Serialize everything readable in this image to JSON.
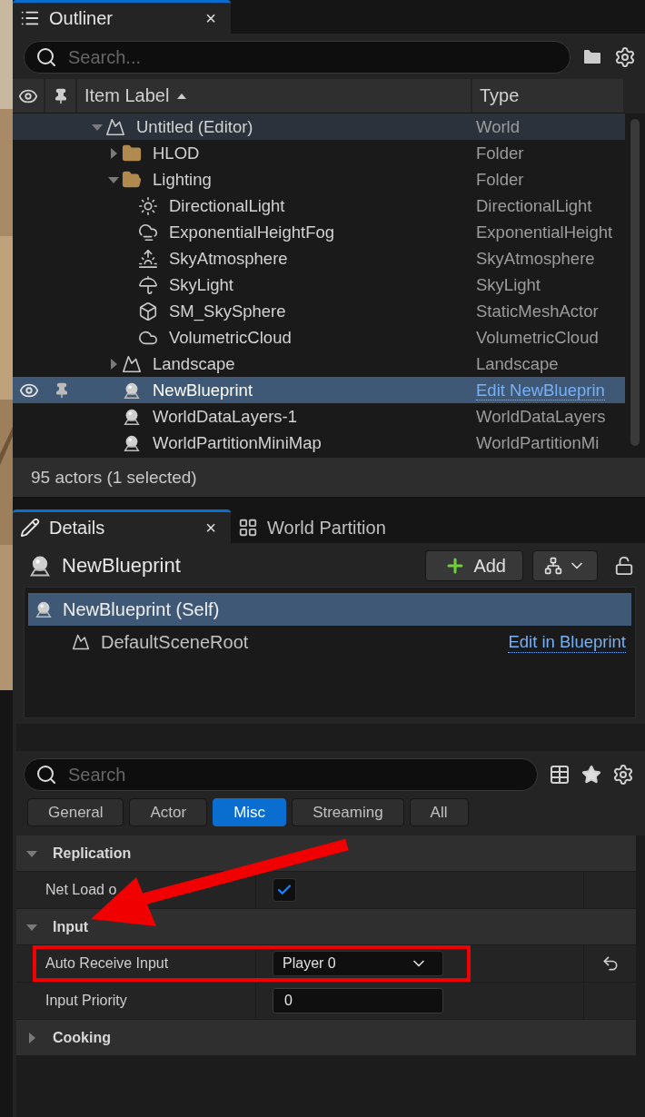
{
  "outliner": {
    "tab": {
      "label": "Outliner",
      "close": "×"
    },
    "search": {
      "placeholder": "Search..."
    },
    "columns": [
      {
        "label": "Item Label",
        "sorted": true
      },
      {
        "label": "Type",
        "sorted": false
      }
    ],
    "tree": [
      {
        "label": "Untitled (Editor)",
        "type": "World",
        "kind": "world",
        "type_link": false,
        "selected": false,
        "hovered": true,
        "expanded": true,
        "children": [
          {
            "label": "HLOD",
            "type": "Folder",
            "kind": "folder",
            "type_link": false,
            "selected": false,
            "hovered": false,
            "expanded": false
          },
          {
            "label": "Lighting",
            "type": "Folder",
            "kind": "folder",
            "type_link": false,
            "selected": false,
            "hovered": false,
            "expanded": true,
            "children": [
              {
                "label": "DirectionalLight",
                "type": "DirectionalLight",
                "kind": "directional-light",
                "type_link": false,
                "selected": false,
                "hovered": false
              },
              {
                "label": "ExponentialHeightFog",
                "type": "ExponentialHeight",
                "kind": "fog",
                "type_link": false,
                "selected": false,
                "hovered": false
              },
              {
                "label": "SkyAtmosphere",
                "type": "SkyAtmosphere",
                "kind": "atmosphere",
                "type_link": false,
                "selected": false,
                "hovered": false
              },
              {
                "label": "SkyLight",
                "type": "SkyLight",
                "kind": "skylight",
                "type_link": false,
                "selected": false,
                "hovered": false
              },
              {
                "label": "SM_SkySphere",
                "type": "StaticMeshActor",
                "kind": "mesh",
                "type_link": false,
                "selected": false,
                "hovered": false
              },
              {
                "label": "VolumetricCloud",
                "type": "VolumetricCloud",
                "kind": "cloud",
                "type_link": false,
                "selected": false,
                "hovered": false
              }
            ]
          },
          {
            "label": "Landscape",
            "type": "Landscape",
            "kind": "landscape",
            "type_link": false,
            "selected": false,
            "hovered": false,
            "expanded": false
          },
          {
            "label": "NewBlueprint",
            "type": "Edit NewBlueprin",
            "kind": "blueprint",
            "type_link": true,
            "selected": true,
            "hovered": false
          },
          {
            "label": "WorldDataLayers-1",
            "type": "WorldDataLayers",
            "kind": "blueprint",
            "type_link": false,
            "selected": false,
            "hovered": false
          },
          {
            "label": "WorldPartitionMiniMap",
            "type": "WorldPartitionMi",
            "kind": "blueprint",
            "type_link": false,
            "selected": false,
            "hovered": false
          }
        ]
      }
    ],
    "status": "95 actors (1 selected)"
  },
  "details": {
    "tabs": [
      {
        "label": "Details",
        "selected": true,
        "close": "×"
      },
      {
        "label": "World Partition",
        "selected": false
      }
    ],
    "actor_name": "NewBlueprint",
    "add_button": "Add",
    "components": [
      {
        "label": "NewBlueprint (Self)",
        "selected": true,
        "kind": "blueprint"
      },
      {
        "label": "DefaultSceneRoot",
        "selected": false,
        "kind": "scene-root",
        "link": "Edit in Blueprint"
      }
    ],
    "search": {
      "placeholder": "Search"
    },
    "filters": [
      {
        "label": "General",
        "selected": false
      },
      {
        "label": "Actor",
        "selected": false
      },
      {
        "label": "Misc",
        "selected": true
      },
      {
        "label": "Streaming",
        "selected": false
      },
      {
        "label": "All",
        "selected": false
      }
    ],
    "sections": [
      {
        "title": "Replication",
        "expanded": true,
        "properties": [
          {
            "label": "Net Load o",
            "kind": "checkbox",
            "checked": true,
            "highlighted": false
          }
        ]
      },
      {
        "title": "Input",
        "expanded": true,
        "properties": [
          {
            "label": "Auto Receive Input",
            "kind": "dropdown",
            "value": "Player 0",
            "highlighted": true,
            "resettable": true
          },
          {
            "label": "Input Priority",
            "kind": "number",
            "value": "0",
            "highlighted": false,
            "resettable": false
          }
        ]
      },
      {
        "title": "Cooking",
        "expanded": false
      }
    ],
    "annotations": [
      {
        "kind": "arrow"
      }
    ]
  }
}
